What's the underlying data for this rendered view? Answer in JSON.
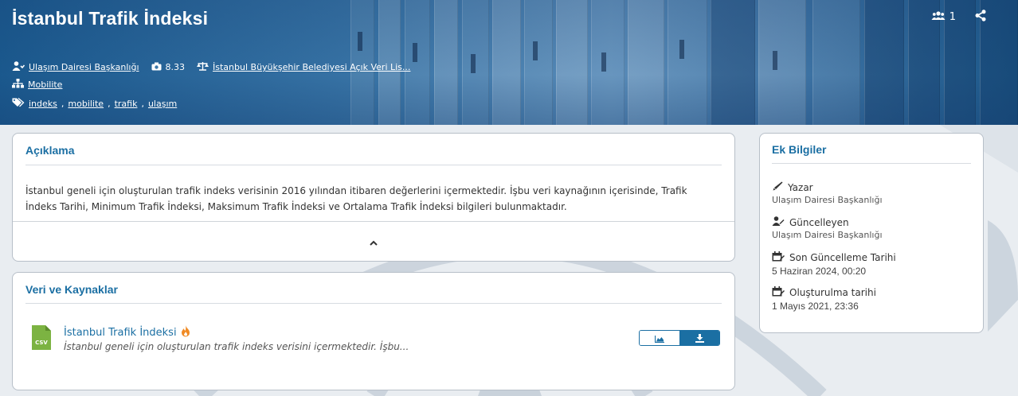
{
  "header": {
    "title": "İstanbul Trafik İndeksi",
    "followers_count": "1",
    "organization": "Ulaşım Dairesi Başkanlığı",
    "score": "8.33",
    "license": "İstanbul Büyükşehir Belediyesi Açık Veri Lis...",
    "category": "Mobilite",
    "tags": [
      "indeks",
      "mobilite",
      "trafik",
      "ulaşım"
    ]
  },
  "description": {
    "title": "Açıklama",
    "text": "İstanbul geneli için oluşturulan trafik indeks verisinin 2016 yılından itibaren değerlerini içermektedir. İşbu veri kaynağının içerisinde, Trafik İndeks Tarihi, Minimum Trafik İndeksi, Maksimum Trafik İndeksi ve Ortalama Trafik İndeksi bilgileri bulunmaktadır."
  },
  "resources": {
    "title": "Veri ve Kaynaklar",
    "items": [
      {
        "format": "CSV",
        "name": "İstanbul Trafik İndeksi",
        "description": "İstanbul geneli için oluşturulan trafik indeks verisini içermektedir. İşbu..."
      }
    ]
  },
  "extra_info": {
    "title": "Ek Bilgiler",
    "author_label": "Yazar",
    "author_value": "Ulaşım Dairesi Başkanlığı",
    "updater_label": "Güncelleyen",
    "updater_value": "Ulaşım Dairesi Başkanlığı",
    "last_updated_label": "Son Güncelleme Tarihi",
    "last_updated_value": "5 Haziran 2024, 00:20",
    "created_label": "Oluşturulma tarihi",
    "created_value": "1 Mayıs 2021, 23:36"
  },
  "icons": {
    "followers": "users-icon",
    "share": "share-icon",
    "organization": "user-tie-icon",
    "score": "camera-icon",
    "license": "balance-scale-icon",
    "category": "sitemap-icon",
    "tags": "tags-icon",
    "author": "pen-icon",
    "updater": "user-edit-icon",
    "calendar": "calendar-edit-icon",
    "collapse": "chevron-up-icon",
    "resource_format": "csv-file-icon",
    "popular": "fire-icon",
    "preview": "area-chart-icon",
    "download": "download-icon"
  },
  "colors": {
    "accent": "#1b6fa3",
    "csv_green": "#7cb342",
    "fire": "#f08a24"
  }
}
